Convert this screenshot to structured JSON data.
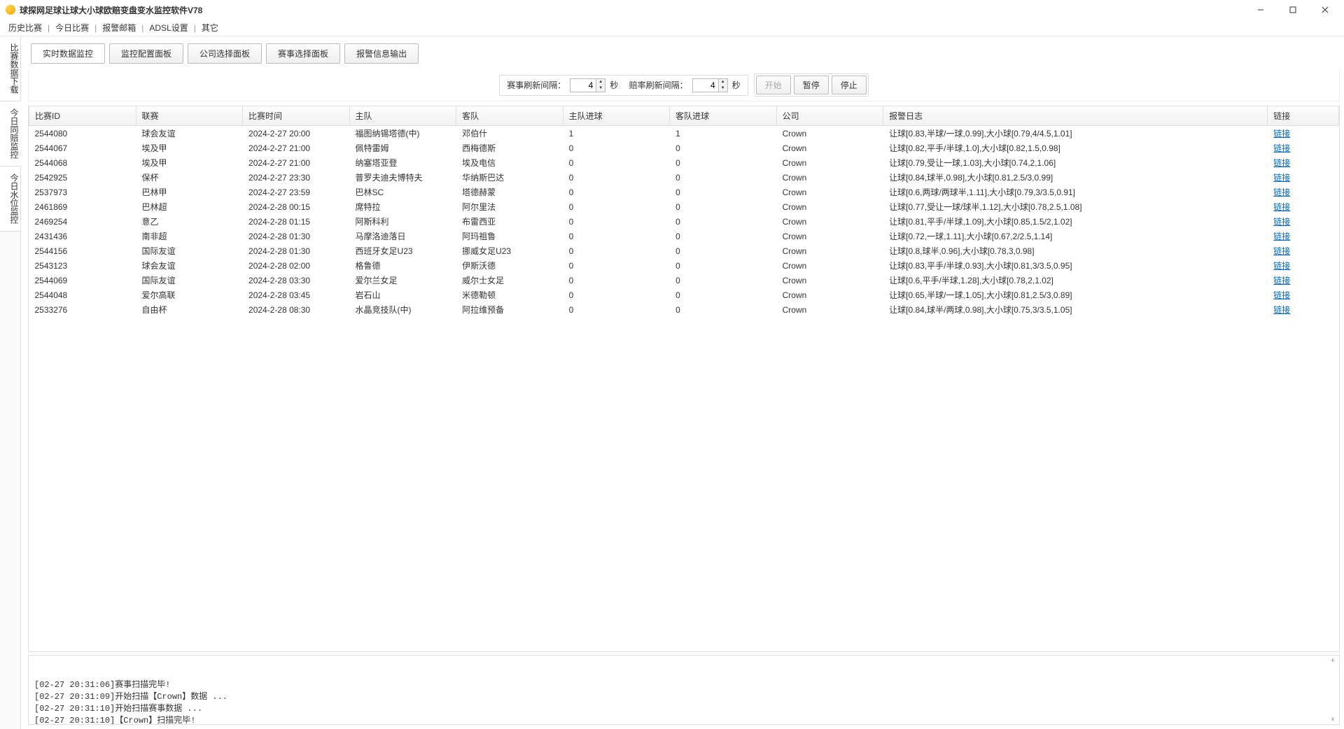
{
  "window": {
    "title": "球探网足球让球大小球欧赔变盘变水监控软件V78"
  },
  "menu": {
    "items": [
      "历史比赛",
      "今日比赛",
      "报警邮箱",
      "ADSL设置",
      "其它"
    ]
  },
  "sidebar": {
    "tabs": [
      "比赛数据下载",
      "今日同赔监控",
      "今日水位监控"
    ]
  },
  "tabbar": {
    "tabs": [
      "实时数据监控",
      "监控配置面板",
      "公司选择面板",
      "赛事选择面板",
      "报警信息输出"
    ]
  },
  "controls": {
    "refresh_match_label": "赛事刷新间隔：",
    "refresh_match_value": "4",
    "refresh_odds_label": "赔率刷新间隔：",
    "refresh_odds_value": "4",
    "seconds": "秒",
    "start": "开始",
    "pause": "暂停",
    "stop": "停止"
  },
  "table": {
    "headers": [
      "比赛ID",
      "联赛",
      "比赛时间",
      "主队",
      "客队",
      "主队进球",
      "客队进球",
      "公司",
      "报警日志",
      "链接"
    ],
    "link_label": "链接",
    "rows": [
      {
        "id": "2544080",
        "league": "球会友谊",
        "time": "2024-2-27 20:00",
        "home": "福图纳锡塔德(中)",
        "away": "邓伯什",
        "hs": "1",
        "as": "1",
        "company": "Crown",
        "alarm": "让球[0.83,半球/一球,0.99],大小球[0.79,4/4.5,1.01]"
      },
      {
        "id": "2544067",
        "league": "埃及甲",
        "time": "2024-2-27 21:00",
        "home": "佩特雷姆",
        "away": "西梅德斯",
        "hs": "0",
        "as": "0",
        "company": "Crown",
        "alarm": "让球[0.82,平手/半球,1.0],大小球[0.82,1.5,0.98]"
      },
      {
        "id": "2544068",
        "league": "埃及甲",
        "time": "2024-2-27 21:00",
        "home": "纳塞塔亚登",
        "away": "埃及电信",
        "hs": "0",
        "as": "0",
        "company": "Crown",
        "alarm": "让球[0.79,受让一球,1.03],大小球[0.74,2,1.06]"
      },
      {
        "id": "2542925",
        "league": "保杯",
        "time": "2024-2-27 23:30",
        "home": "普罗夫迪夫博特夫",
        "away": "华纳斯巴达",
        "hs": "0",
        "as": "0",
        "company": "Crown",
        "alarm": "让球[0.84,球半,0.98],大小球[0.81,2.5/3,0.99]"
      },
      {
        "id": "2537973",
        "league": "巴林甲",
        "time": "2024-2-27 23:59",
        "home": "巴林SC",
        "away": "塔德赫蒙",
        "hs": "0",
        "as": "0",
        "company": "Crown",
        "alarm": "让球[0.6,两球/两球半,1.11],大小球[0.79,3/3.5,0.91]"
      },
      {
        "id": "2461869",
        "league": "巴林超",
        "time": "2024-2-28 00:15",
        "home": "席特拉",
        "away": "阿尔里法",
        "hs": "0",
        "as": "0",
        "company": "Crown",
        "alarm": "让球[0.77,受让一球/球半,1.12],大小球[0.78,2.5,1.08]"
      },
      {
        "id": "2469254",
        "league": "意乙",
        "time": "2024-2-28 01:15",
        "home": "阿斯科利",
        "away": "布雷西亚",
        "hs": "0",
        "as": "0",
        "company": "Crown",
        "alarm": "让球[0.81,平手/半球,1.09],大小球[0.85,1.5/2,1.02]"
      },
      {
        "id": "2431436",
        "league": "南非超",
        "time": "2024-2-28 01:30",
        "home": "马摩洛迪落日",
        "away": "阿玛祖鲁",
        "hs": "0",
        "as": "0",
        "company": "Crown",
        "alarm": "让球[0.72,一球,1.11],大小球[0.67,2/2.5,1.14]"
      },
      {
        "id": "2544156",
        "league": "国际友谊",
        "time": "2024-2-28 01:30",
        "home": "西班牙女足U23",
        "away": "挪威女足U23",
        "hs": "0",
        "as": "0",
        "company": "Crown",
        "alarm": "让球[0.8,球半,0.96],大小球[0.78,3,0.98]"
      },
      {
        "id": "2543123",
        "league": "球会友谊",
        "time": "2024-2-28 02:00",
        "home": "格鲁德",
        "away": "伊斯沃德",
        "hs": "0",
        "as": "0",
        "company": "Crown",
        "alarm": "让球[0.83,平手/半球,0.93],大小球[0.81,3/3.5,0.95]"
      },
      {
        "id": "2544069",
        "league": "国际友谊",
        "time": "2024-2-28 03:30",
        "home": "爱尔兰女足",
        "away": "威尔士女足",
        "hs": "0",
        "as": "0",
        "company": "Crown",
        "alarm": "让球[0.6,平手/半球,1.28],大小球[0.78,2,1.02]"
      },
      {
        "id": "2544048",
        "league": "爱尔高联",
        "time": "2024-2-28 03:45",
        "home": "岩石山",
        "away": "米德勒顿",
        "hs": "0",
        "as": "0",
        "company": "Crown",
        "alarm": "让球[0.65,半球/一球,1.05],大小球[0.81,2.5/3,0.89]"
      },
      {
        "id": "2533276",
        "league": "自由杯",
        "time": "2024-2-28 08:30",
        "home": "水晶竞技队(中)",
        "away": "阿拉维预备",
        "hs": "0",
        "as": "0",
        "company": "Crown",
        "alarm": "让球[0.84,球半/两球,0.98],大小球[0.75,3/3.5,1.05]"
      }
    ]
  },
  "log": {
    "lines": [
      "[02-27 20:31:06]赛事扫描完毕!",
      "[02-27 20:31:09]开始扫描【Crown】数据 ...",
      "[02-27 20:31:10]开始扫描赛事数据 ...",
      "[02-27 20:31:10]【Crown】扫描完毕!"
    ]
  }
}
